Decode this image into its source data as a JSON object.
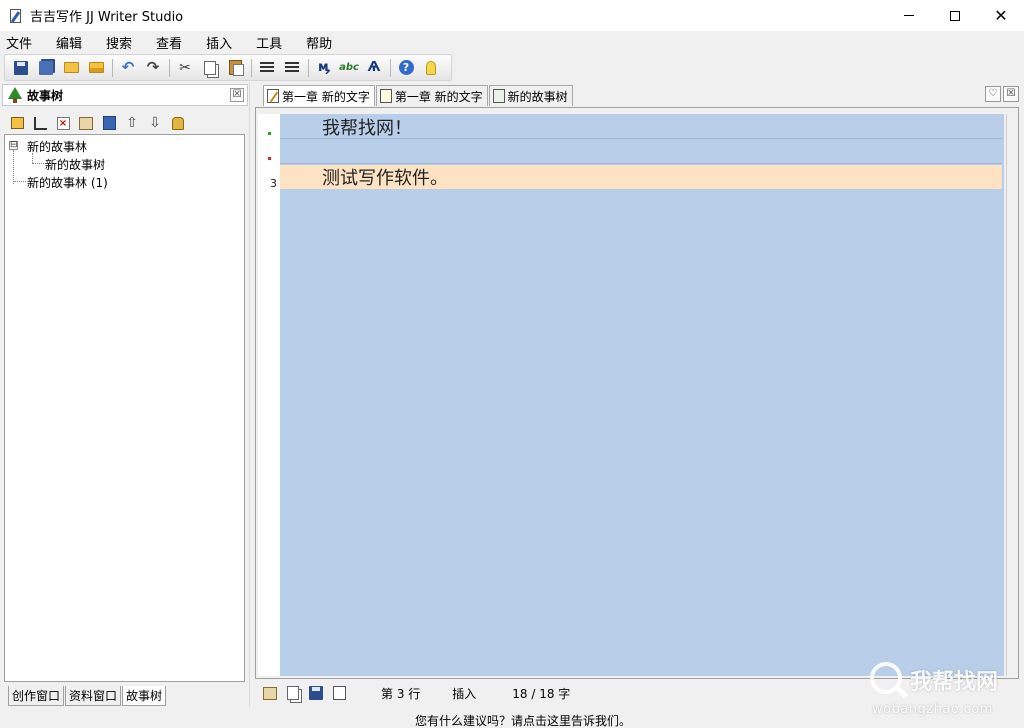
{
  "window": {
    "title": "吉吉写作 JJ Writer Studio",
    "minimize_glyph": "",
    "close_glyph": "✕"
  },
  "menu": [
    "文件",
    "编辑",
    "搜索",
    "查看",
    "插入",
    "工具",
    "帮助"
  ],
  "toolbar": {
    "buttons": [
      "save-icon",
      "save-all-icon",
      "open-icon",
      "open-recent-icon",
      "undo-icon",
      "redo-icon",
      "cut-icon",
      "copy-icon",
      "paste-icon",
      "indent-icon",
      "outdent-icon",
      "find-icon",
      "spellcheck-icon",
      "replace-icon",
      "help-icon",
      "tip-icon"
    ]
  },
  "left_panel": {
    "title": "故事树",
    "close_glyph": "☒",
    "tree": [
      {
        "label": "新的故事林",
        "toggle": "⊟"
      },
      {
        "label": "新的故事树"
      },
      {
        "label": "新的故事林 (1)"
      }
    ],
    "bottom_tabs": [
      "创作窗口",
      "资料窗口",
      "故事树"
    ],
    "active_tab": "故事树"
  },
  "doc_tabs": [
    {
      "label": "第一章 新的文字",
      "icon": "edit-doc-icon",
      "active": true
    },
    {
      "label": "第一章 新的文字",
      "icon": "note-doc-icon",
      "active": false
    },
    {
      "label": "新的故事树",
      "icon": "story-tree-icon",
      "active": false
    }
  ],
  "doc_controls": {
    "pin": "♡",
    "close": "☒"
  },
  "editor": {
    "lines": [
      "我帮找网！",
      "",
      "测试写作软件。"
    ],
    "current_line_number": "3",
    "colors": {
      "background": "#b9cfe9",
      "current_line": "#fde3c4"
    }
  },
  "status": {
    "line": "第 3 行",
    "mode": "插入",
    "count": "18 / 18 字"
  },
  "footer_note": "您有什么建议吗？请点击这里告诉我们。",
  "watermark": {
    "main": "我帮找网",
    "sub": "wobangzhao.com"
  }
}
